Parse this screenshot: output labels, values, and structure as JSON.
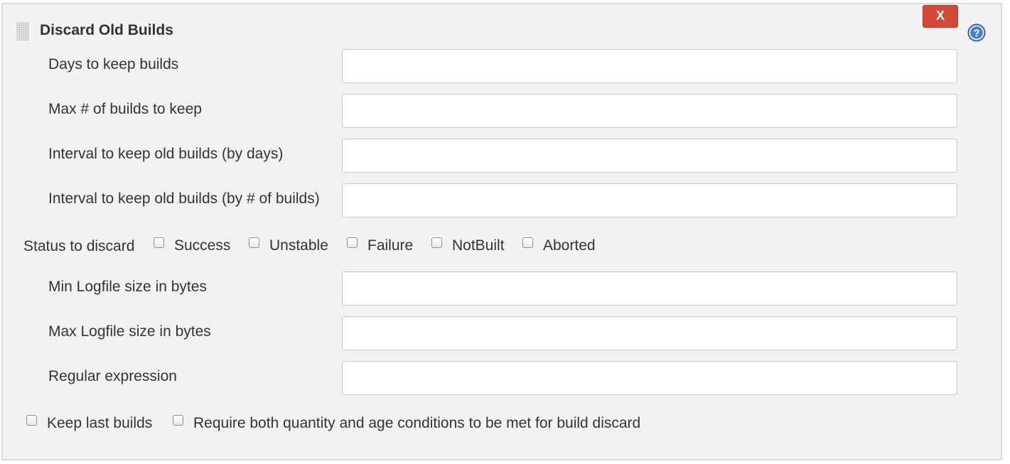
{
  "section": {
    "title": "Discard Old Builds",
    "delete_label": "X",
    "help_icon": "question-circle-icon",
    "drag_icon": "drag-handle-icon"
  },
  "fields": {
    "days_to_keep": {
      "label": "Days to keep builds",
      "value": ""
    },
    "max_builds": {
      "label": "Max # of builds to keep",
      "value": ""
    },
    "interval_days": {
      "label": "Interval to keep old builds (by days)",
      "value": ""
    },
    "interval_builds": {
      "label": "Interval to keep old builds (by # of builds)",
      "value": ""
    },
    "min_logfile": {
      "label": "Min Logfile size in bytes",
      "value": ""
    },
    "max_logfile": {
      "label": "Max Logfile size in bytes",
      "value": ""
    },
    "regex": {
      "label": "Regular expression",
      "value": ""
    }
  },
  "status": {
    "label": "Status to discard",
    "options": [
      {
        "label": "Success",
        "checked": false
      },
      {
        "label": "Unstable",
        "checked": false
      },
      {
        "label": "Failure",
        "checked": false
      },
      {
        "label": "NotBuilt",
        "checked": false
      },
      {
        "label": "Aborted",
        "checked": false
      }
    ]
  },
  "options": {
    "keep_last": {
      "label": "Keep last builds",
      "checked": false
    },
    "require_both": {
      "label": "Require both quantity and age conditions to be met for build discard",
      "checked": false
    }
  },
  "colors": {
    "panel_bg": "#f2f2f2",
    "delete_button": "#d24939",
    "help_icon": "#4a7ec1"
  }
}
